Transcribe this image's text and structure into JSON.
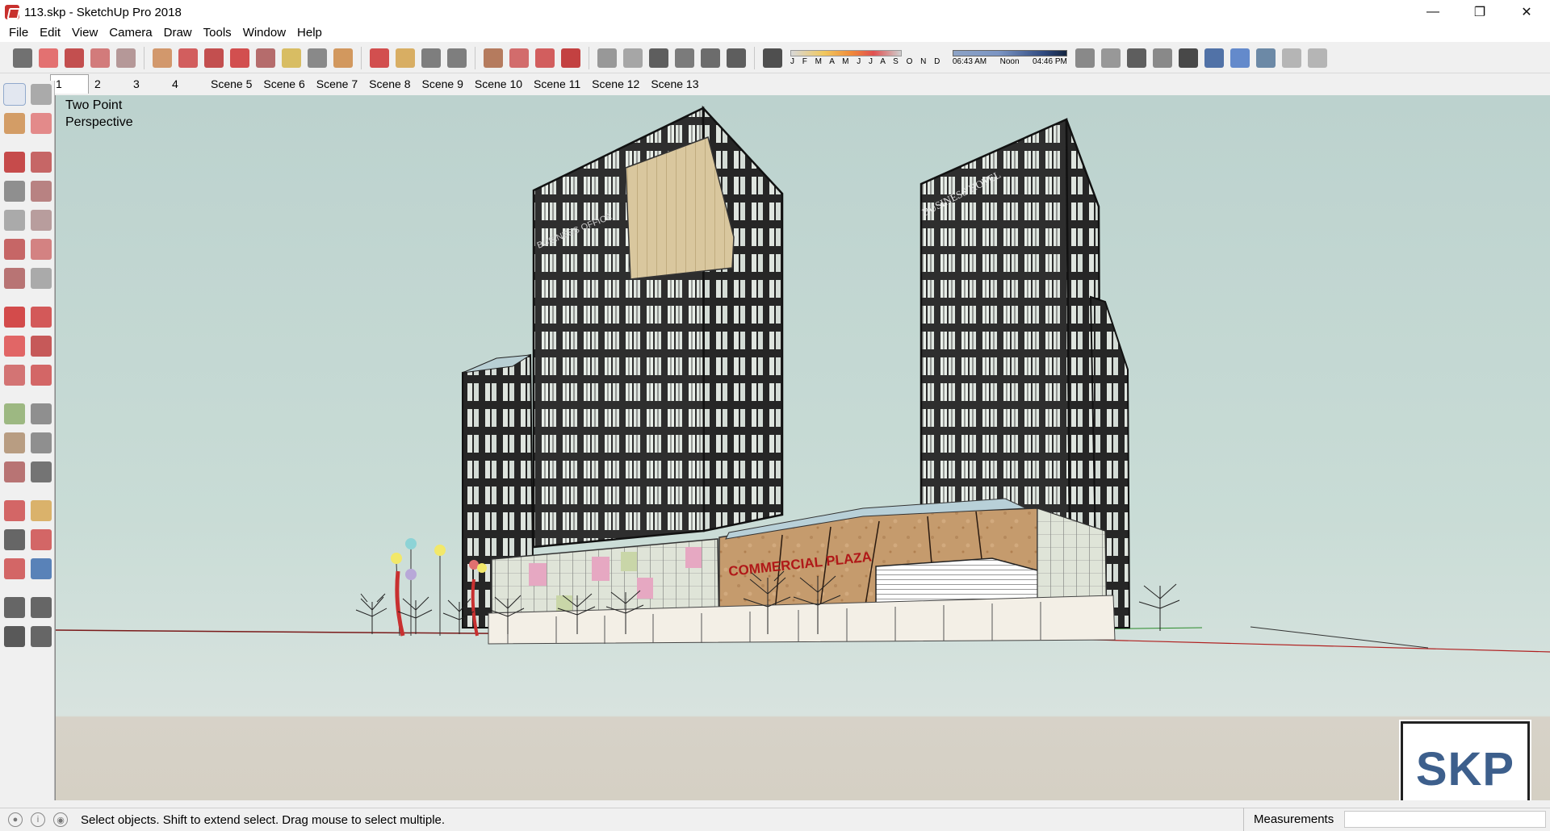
{
  "window": {
    "title": "113.skp - SketchUp Pro 2018",
    "minimize": "—",
    "restore": "❐",
    "close": "✕"
  },
  "menu": [
    "File",
    "Edit",
    "View",
    "Camera",
    "Draw",
    "Tools",
    "Window",
    "Help"
  ],
  "shadow_settings": {
    "months": "J F M A M J J A S O N D",
    "time_start": "06:43 AM",
    "time_mid": "Noon",
    "time_end": "04:46 PM"
  },
  "scenes": [
    "1",
    "2",
    "3",
    "4",
    "Scene 5",
    "Scene 6",
    "Scene 7",
    "Scene 8",
    "Scene 9",
    "Scene 10",
    "Scene 11",
    "Scene 12",
    "Scene 13"
  ],
  "active_scene": "1",
  "viewport": {
    "camera_label": "Two Point\nPerspective",
    "signs": {
      "office": "BUSINESS OFFICE",
      "hotel": "BUSINESS HOTEL",
      "plaza": "COMMERCIAL PLAZA"
    },
    "logo": "SKP"
  },
  "status": {
    "message": "Select objects. Shift to extend select. Drag mouse to select multiple.",
    "measurements_label": "Measurements",
    "measurements_value": ""
  },
  "colors": {
    "tower": "#2a2a2a",
    "plaza": "#c49a6c",
    "accent_red": "#c8302d",
    "sky": "#c4d8d2"
  },
  "icons": {
    "top_toolbar": [
      "select-icon",
      "eraser-icon",
      "pencil-icon",
      "arc-icon",
      "rectangle-icon",
      "push-pull-icon",
      "follow-me-icon",
      "move-icon",
      "rotate-icon",
      "scale-icon",
      "tape-measure-icon",
      "text-icon",
      "paint-bucket-icon",
      "orbit-icon",
      "pan-icon",
      "zoom-icon",
      "zoom-extents-icon",
      "warehouse-icon",
      "extension-icon",
      "layout-icon",
      "ruby-icon",
      "iso-view-icon",
      "top-view-icon",
      "front-view-icon",
      "right-view-icon",
      "back-view-icon",
      "left-view-icon",
      "shadows-icon",
      "xray-icon",
      "back-edges-icon",
      "wireframe-icon",
      "hidden-line-icon",
      "shaded-icon",
      "shaded-textures-icon",
      "monochrome-icon",
      "sandbox-icon",
      "section-plane-icon",
      "section-display-icon"
    ],
    "left_toolbar": [
      "select-icon",
      "component-icon",
      "paint-bucket-icon",
      "eraser-icon",
      "line-icon",
      "freehand-icon",
      "rectangle-icon",
      "rotated-rectangle-icon",
      "circle-icon",
      "polygon-icon",
      "arc-icon",
      "two-point-arc-icon",
      "three-point-arc-icon",
      "pie-icon",
      "move-icon",
      "push-pull-icon",
      "rotate-icon",
      "follow-me-icon",
      "scale-icon",
      "offset-icon",
      "tape-measure-icon",
      "dimension-icon",
      "protractor-icon",
      "text-icon",
      "axes-icon",
      "3d-text-icon",
      "orbit-icon",
      "pan-icon",
      "zoom-icon",
      "zoom-window-icon",
      "zoom-extents-icon",
      "previous-view-icon",
      "position-camera-icon",
      "look-around-icon",
      "walk-icon",
      "section-plane-icon"
    ]
  }
}
